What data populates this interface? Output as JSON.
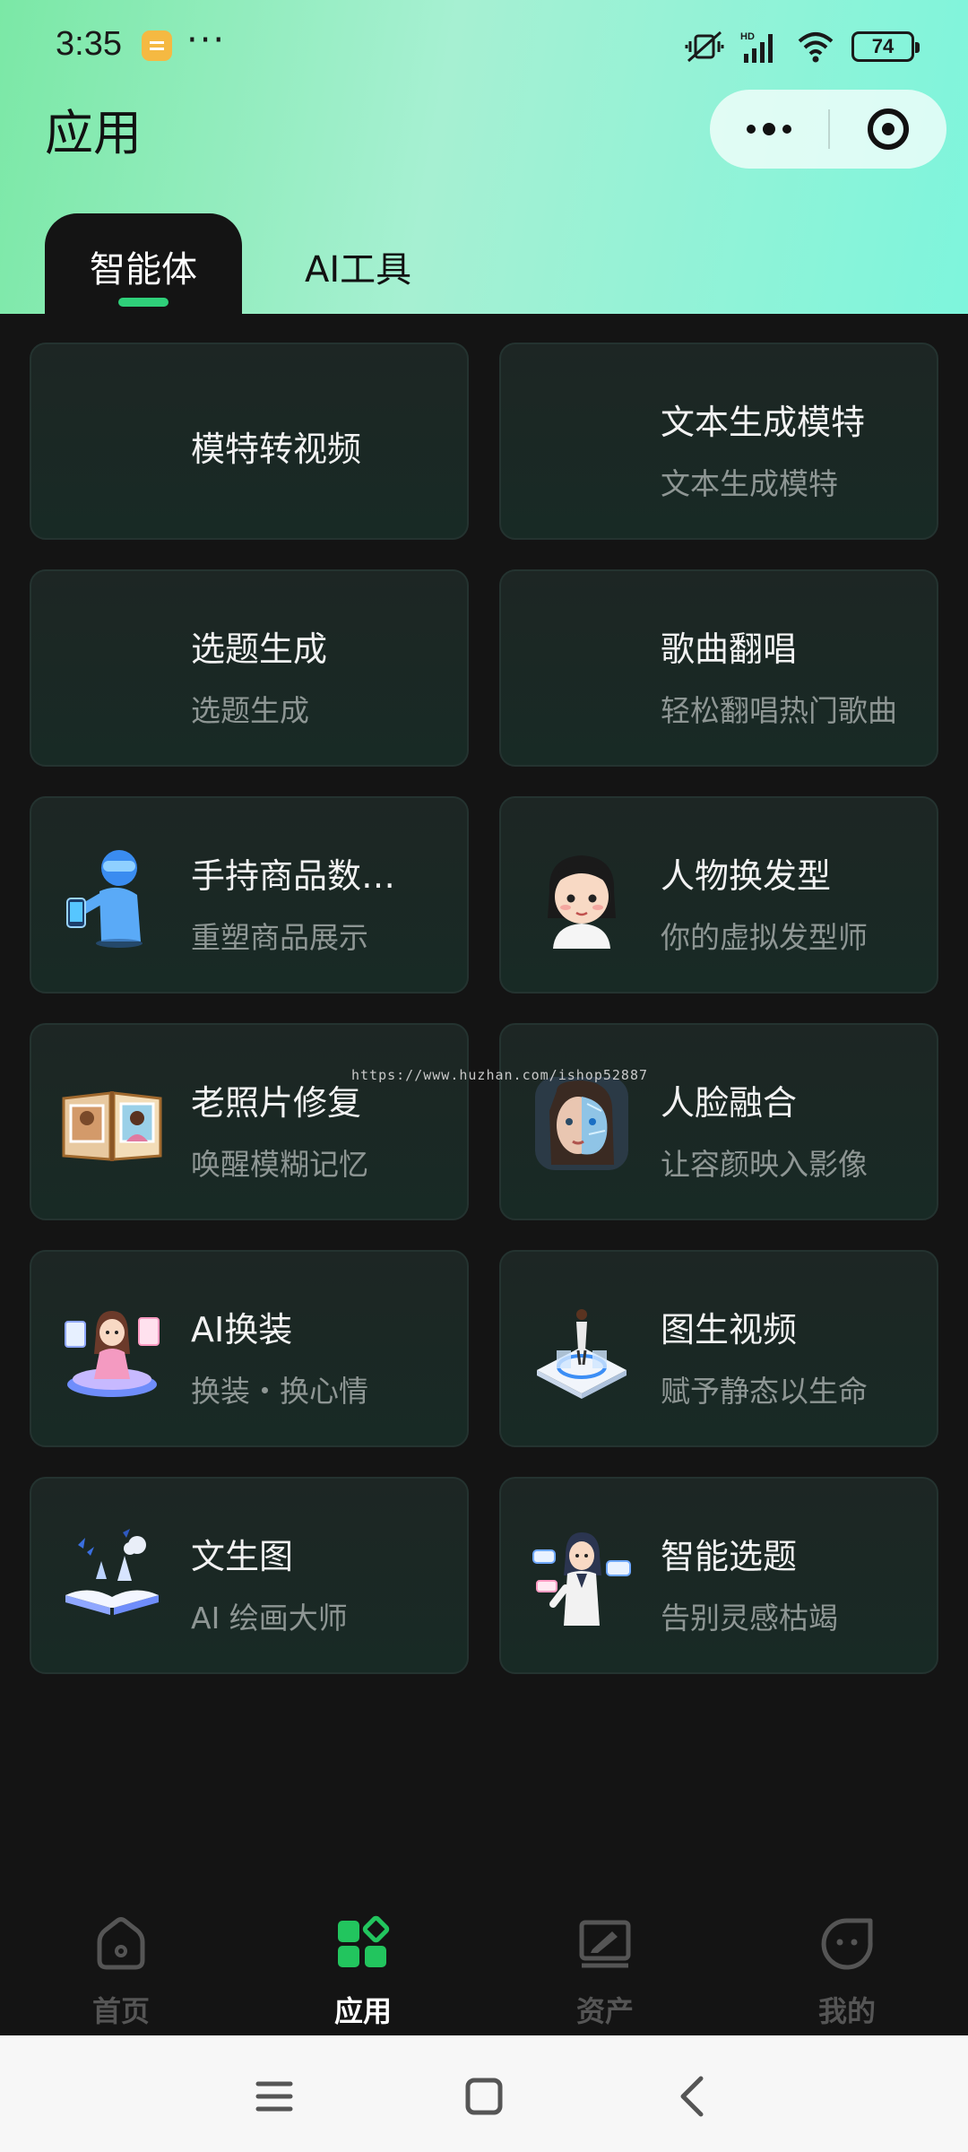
{
  "status_bar": {
    "time": "3:35",
    "dots": "···",
    "battery": "74",
    "signal_label": "HD"
  },
  "header": {
    "title": "应用"
  },
  "tabs": [
    {
      "label": "智能体",
      "active": true
    },
    {
      "label": "AI工具",
      "active": false
    }
  ],
  "cards": [
    {
      "title": "模特转视频",
      "subtitle": "",
      "icon": "none"
    },
    {
      "title": "文本生成模特",
      "subtitle": "文本生成模特",
      "icon": "none"
    },
    {
      "title": "选题生成",
      "subtitle": "选题生成",
      "icon": "none"
    },
    {
      "title": "歌曲翻唱",
      "subtitle": "轻松翻唱热门歌曲",
      "icon": "none"
    },
    {
      "title": "手持商品数…",
      "subtitle": "重塑商品展示",
      "icon": "blue-figure-phone-icon"
    },
    {
      "title": "人物换发型",
      "subtitle": "你的虚拟发型师",
      "icon": "cartoon-girl-icon"
    },
    {
      "title": "老照片修复",
      "subtitle": "唤醒模糊记忆",
      "icon": "photo-album-icon"
    },
    {
      "title": "人脸融合",
      "subtitle": "让容颜映入影像",
      "icon": "cyborg-face-icon"
    },
    {
      "title": "AI换装",
      "subtitle": "换装・换心情",
      "icon": "dressing-girl-icon"
    },
    {
      "title": "图生视频",
      "subtitle": "赋予静态以生命",
      "icon": "hologram-stage-icon"
    },
    {
      "title": "文生图",
      "subtitle": "AI 绘画大师",
      "icon": "magic-book-icon"
    },
    {
      "title": "智能选题",
      "subtitle": "告别灵感枯竭",
      "icon": "anime-assistant-icon"
    }
  ],
  "watermark": "https://www.huzhan.com/ishop52887",
  "bottom_nav": [
    {
      "label": "首页",
      "icon": "home-icon",
      "active": false
    },
    {
      "label": "应用",
      "icon": "apps-icon",
      "active": true
    },
    {
      "label": "资产",
      "icon": "assets-icon",
      "active": false
    },
    {
      "label": "我的",
      "icon": "profile-icon",
      "active": false
    }
  ],
  "colors": {
    "accent": "#2fd07a",
    "header_gradient_start": "#7be8a6",
    "header_gradient_end": "#7ef5dc",
    "background": "#141414",
    "card_bg": "#1b2826"
  }
}
